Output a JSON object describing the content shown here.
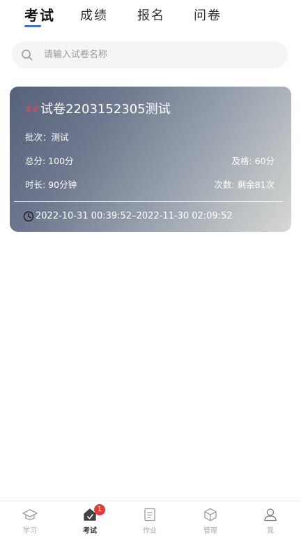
{
  "tabs": [
    {
      "label": "考试",
      "active": true
    },
    {
      "label": "成绩",
      "active": false
    },
    {
      "label": "报名",
      "active": false
    },
    {
      "label": "问卷",
      "active": false
    }
  ],
  "search": {
    "placeholder": "请输入试卷名称",
    "value": "",
    "icon": "search-icon"
  },
  "exam_card": {
    "tag": "##",
    "title": "试卷2203152305测试",
    "batch": "批次：测试",
    "total_score": "总分: 100分",
    "pass_score": "及格: 60分",
    "duration": "时长: 90分钟",
    "attempts": "次数: 剩余81次",
    "time_range": "2022-10-31 00:39:52–2022-11-30 02:09:52",
    "clock_icon": "clock-icon"
  },
  "bottom_nav": [
    {
      "label": "学习",
      "icon": "graduation-cap-icon",
      "active": false
    },
    {
      "label": "考试",
      "icon": "exam-icon",
      "active": true,
      "badge": "1"
    },
    {
      "label": "作业",
      "icon": "document-icon",
      "active": false
    },
    {
      "label": "管理",
      "icon": "cube-icon",
      "active": false
    },
    {
      "label": "我",
      "icon": "user-icon",
      "active": false
    }
  ],
  "colors": {
    "accent": "#3a73e6",
    "badge": "#e53935",
    "tag": "#e8495a",
    "card_gradient_start": "#56627a",
    "card_gradient_end": "#d6d8d4"
  }
}
